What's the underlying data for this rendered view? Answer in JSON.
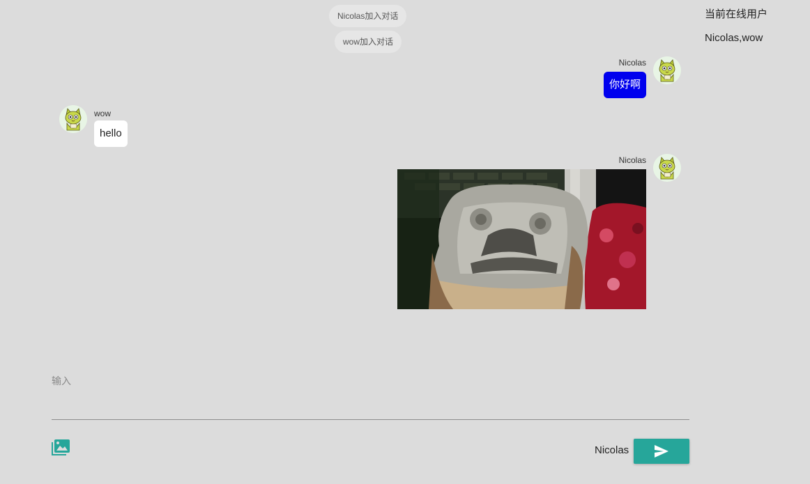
{
  "system_messages": [
    {
      "text": "Nicolas加入对话"
    },
    {
      "text": "wow加入对话"
    }
  ],
  "messages": [
    {
      "sender": "Nicolas",
      "text": "你好啊",
      "type": "text",
      "mine": true
    },
    {
      "sender": "wow",
      "text": "hello",
      "type": "text",
      "mine": false
    },
    {
      "sender": "Nicolas",
      "type": "image",
      "mine": true
    }
  ],
  "sidebar": {
    "title": "当前在线用户",
    "online_users": "Nicolas,wow"
  },
  "composer": {
    "input_label": "输入",
    "input_value": "",
    "upload_icon": "image-library-icon",
    "current_user": "Nicolas",
    "send_icon": "send-icon"
  },
  "colors": {
    "background": "#dcdcdc",
    "my_bubble": "#0000ee",
    "their_bubble": "#ffffff",
    "send_button": "#26a69a",
    "upload_icon": "#26a69a"
  }
}
